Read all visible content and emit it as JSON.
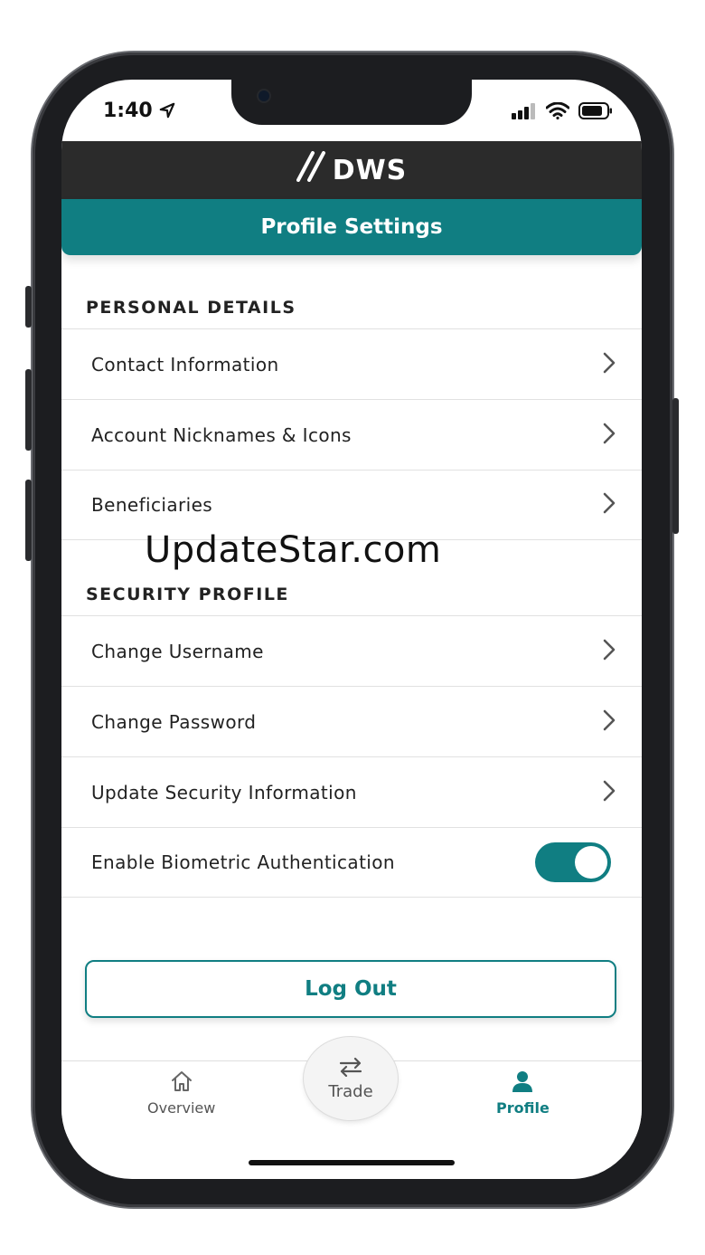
{
  "status_bar": {
    "time": "1:40"
  },
  "header": {
    "logo_text": "DWS",
    "title": "Profile Settings"
  },
  "personal_details": {
    "heading": "PERSONAL DETAILS",
    "items": [
      {
        "label": "Contact Information"
      },
      {
        "label": "Account Nicknames & Icons"
      },
      {
        "label": "Beneficiaries"
      }
    ]
  },
  "security_profile": {
    "heading": "SECURITY PROFILE",
    "items": [
      {
        "label": "Change Username"
      },
      {
        "label": "Change Password"
      },
      {
        "label": "Update Security Information"
      }
    ],
    "biometric": {
      "label": "Enable Biometric Authentication",
      "enabled": true
    }
  },
  "logout_label": "Log Out",
  "watermark": "UpdateStar.com",
  "tabbar": {
    "overview": "Overview",
    "trade": "Trade",
    "profile": "Profile"
  },
  "colors": {
    "accent": "#107e82",
    "header_dark": "#2b2b2b"
  }
}
